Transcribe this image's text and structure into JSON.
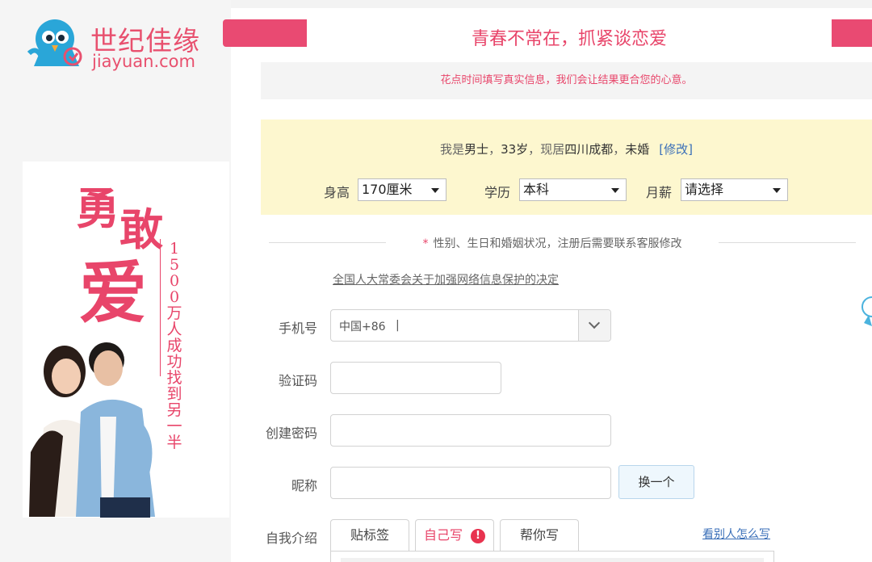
{
  "brand": {
    "name_cn": "世纪佳缘",
    "domain": "jiayuan.com",
    "color": "#e8506e"
  },
  "ad": {
    "word1": "勇",
    "word2": "敢",
    "word3": "爱",
    "vertical_text": "1500万人成功找到另一半"
  },
  "header": {
    "headline": "青春不常在，抓紧谈恋爱",
    "tip": "花点时间填写真实信息，我们会让结果更合您的心意。"
  },
  "profile": {
    "summary_prefix": "我是",
    "gender": "男士",
    "age": "33岁",
    "city_prefix": "现居",
    "city": "四川成都",
    "marital": "未婚",
    "modify_label": "[修改]",
    "height": {
      "label": "身高",
      "value": "170厘米"
    },
    "education": {
      "label": "学历",
      "value": "本科"
    },
    "income": {
      "label": "月薪",
      "value": "请选择"
    }
  },
  "notice": {
    "star": "*",
    "text": "性别、生日和婚姻状况，注册后需要联系客服修改"
  },
  "law_link": "全国人大常委会关于加强网络信息保护的决定",
  "form": {
    "phone_label": "手机号",
    "phone_prefix": "中国+86",
    "phone_caret": "|",
    "code_label": "验证码",
    "password_label": "创建密码",
    "nickname_label": "昵称",
    "change_button": "换一个",
    "intro_label": "自我介绍",
    "tabs": [
      "贴标签",
      "自己写",
      "帮你写"
    ],
    "warning_mark": "!",
    "see_others": "看别人怎么写"
  },
  "colors": {
    "accent": "#e8456a",
    "info_bg": "#fdf7cf",
    "link": "#3a6fb8"
  }
}
